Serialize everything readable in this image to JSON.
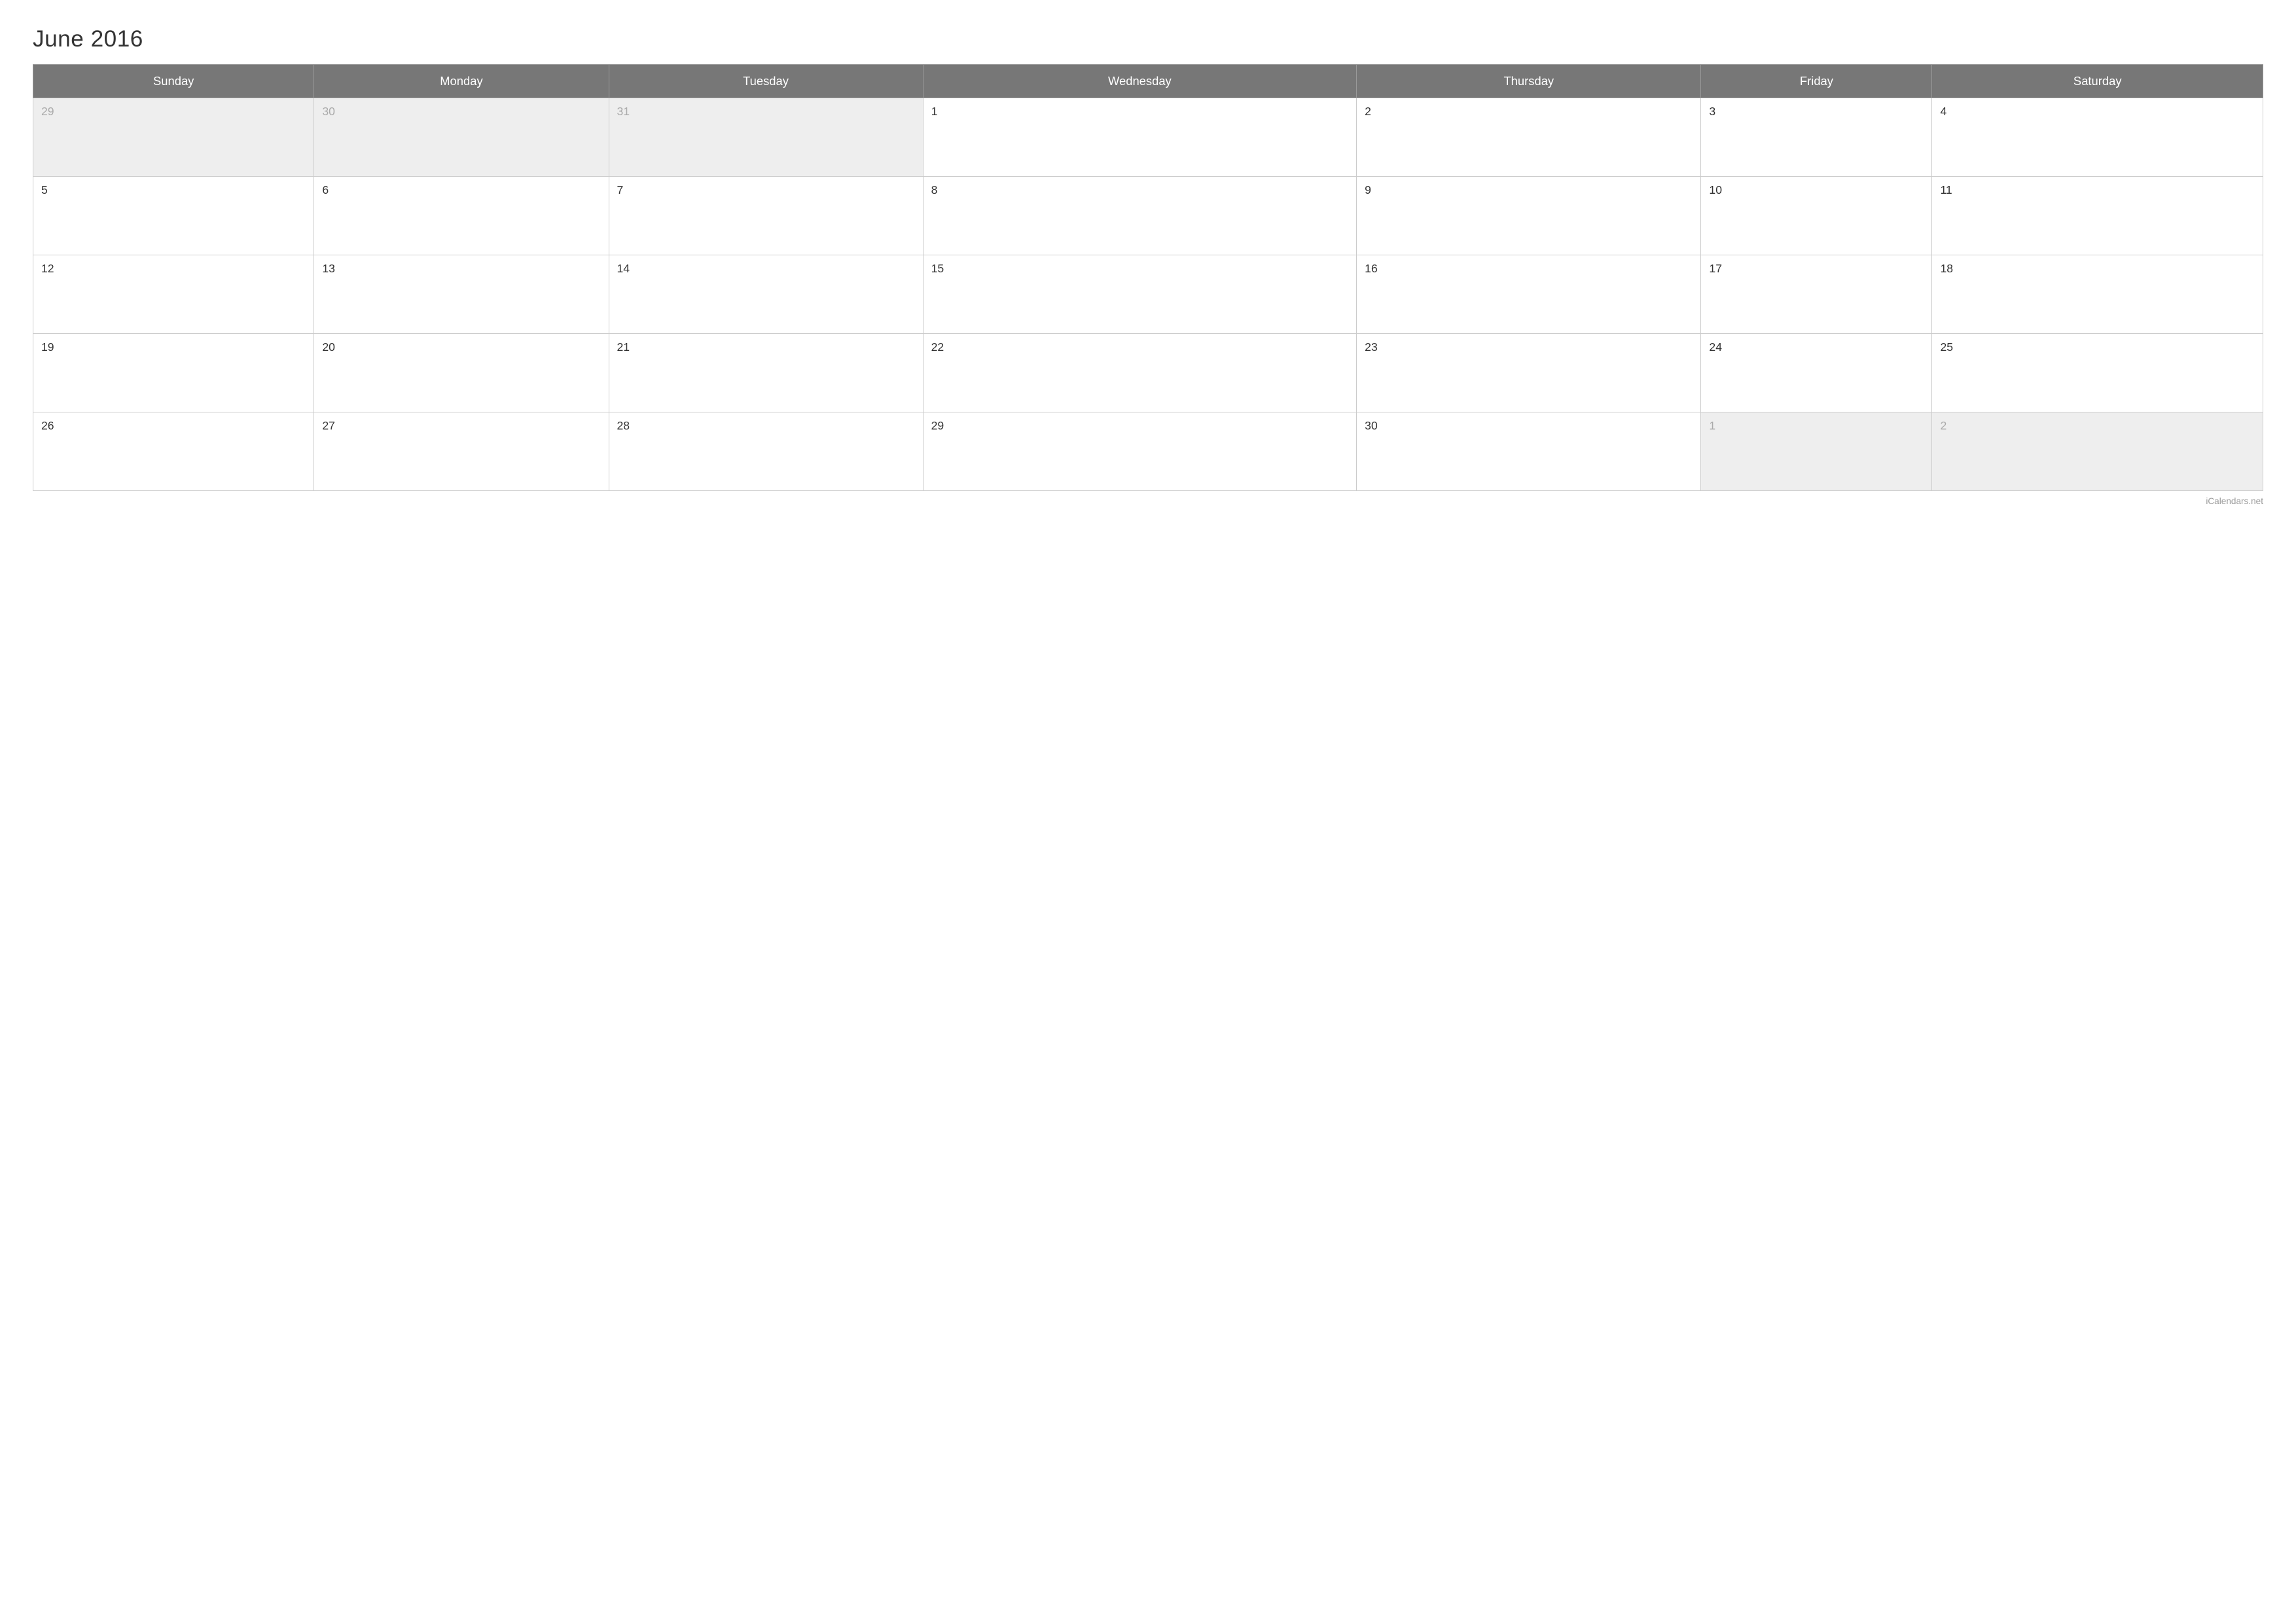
{
  "title": "June 2016",
  "watermark": "iCalendars.net",
  "headers": [
    "Sunday",
    "Monday",
    "Tuesday",
    "Wednesday",
    "Thursday",
    "Friday",
    "Saturday"
  ],
  "weeks": [
    [
      {
        "day": "29",
        "out": true
      },
      {
        "day": "30",
        "out": true
      },
      {
        "day": "31",
        "out": true
      },
      {
        "day": "1",
        "out": false
      },
      {
        "day": "2",
        "out": false
      },
      {
        "day": "3",
        "out": false
      },
      {
        "day": "4",
        "out": false
      }
    ],
    [
      {
        "day": "5",
        "out": false
      },
      {
        "day": "6",
        "out": false
      },
      {
        "day": "7",
        "out": false
      },
      {
        "day": "8",
        "out": false
      },
      {
        "day": "9",
        "out": false
      },
      {
        "day": "10",
        "out": false
      },
      {
        "day": "11",
        "out": false
      }
    ],
    [
      {
        "day": "12",
        "out": false
      },
      {
        "day": "13",
        "out": false
      },
      {
        "day": "14",
        "out": false
      },
      {
        "day": "15",
        "out": false
      },
      {
        "day": "16",
        "out": false
      },
      {
        "day": "17",
        "out": false
      },
      {
        "day": "18",
        "out": false
      }
    ],
    [
      {
        "day": "19",
        "out": false
      },
      {
        "day": "20",
        "out": false
      },
      {
        "day": "21",
        "out": false
      },
      {
        "day": "22",
        "out": false
      },
      {
        "day": "23",
        "out": false
      },
      {
        "day": "24",
        "out": false
      },
      {
        "day": "25",
        "out": false
      }
    ],
    [
      {
        "day": "26",
        "out": false
      },
      {
        "day": "27",
        "out": false
      },
      {
        "day": "28",
        "out": false
      },
      {
        "day": "29",
        "out": false
      },
      {
        "day": "30",
        "out": false
      },
      {
        "day": "1",
        "out": true
      },
      {
        "day": "2",
        "out": true
      }
    ]
  ]
}
